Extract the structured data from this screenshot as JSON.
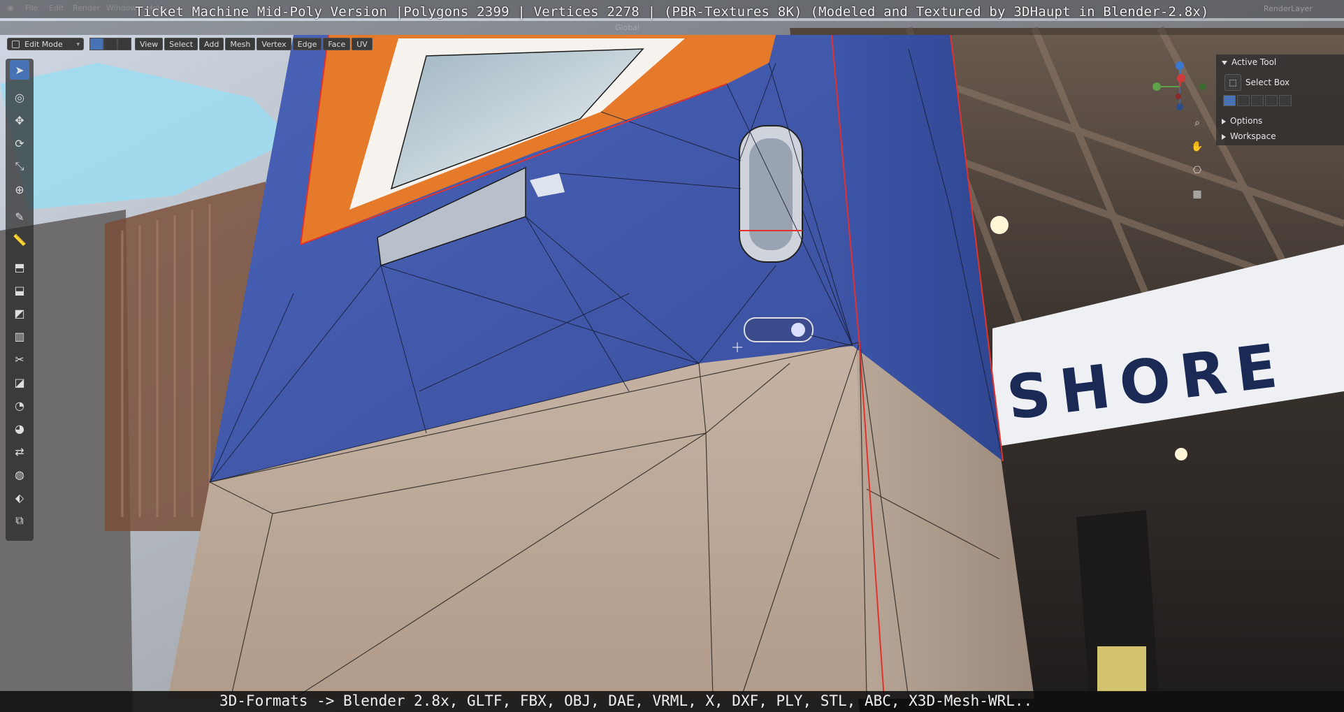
{
  "window": {
    "caption": "Ticket Machine Mid-Poly Version |Polygons 2399 | Vertices 2278 | (PBR-Textures 8K) (Modeled and Textured by 3DHaupt in Blender-2.8x)",
    "render_layer": "RenderLayer"
  },
  "topbar": {
    "menu": [
      "File",
      "Edit",
      "Render",
      "Window",
      "Help"
    ]
  },
  "viewport_header": {
    "mode": "Edit Mode",
    "menus": [
      "View",
      "Select",
      "Add",
      "Mesh",
      "Vertex",
      "Edge",
      "Face",
      "UV"
    ],
    "transform_orientation": "Global"
  },
  "toolbar": {
    "tools": [
      {
        "name": "select-box",
        "icon": "cursor-arrow-icon",
        "active": true
      },
      {
        "name": "cursor",
        "icon": "crosshair-cursor-icon",
        "active": false
      },
      {
        "name": "move",
        "icon": "move-arrows-icon",
        "active": false
      },
      {
        "name": "rotate",
        "icon": "rotate-icon",
        "active": false
      },
      {
        "name": "scale",
        "icon": "scale-icon",
        "active": false
      },
      {
        "name": "transform",
        "icon": "transform-icon",
        "active": false
      },
      {
        "name": "annotate",
        "icon": "annotate-pen-icon",
        "active": false
      },
      {
        "name": "measure",
        "icon": "ruler-icon",
        "active": false
      },
      {
        "name": "extrude",
        "icon": "extrude-icon",
        "active": false
      },
      {
        "name": "inset",
        "icon": "inset-icon",
        "active": false
      },
      {
        "name": "bevel",
        "icon": "bevel-icon",
        "active": false
      },
      {
        "name": "loop-cut",
        "icon": "loop-cut-icon",
        "active": false
      },
      {
        "name": "knife",
        "icon": "knife-icon",
        "active": false
      },
      {
        "name": "poly-build",
        "icon": "poly-build-icon",
        "active": false
      },
      {
        "name": "spin",
        "icon": "spin-icon",
        "active": false
      },
      {
        "name": "smooth",
        "icon": "smooth-icon",
        "active": false
      },
      {
        "name": "edge-slide",
        "icon": "edge-slide-icon",
        "active": false
      },
      {
        "name": "shrink-fatten",
        "icon": "shrink-fatten-icon",
        "active": false
      },
      {
        "name": "shear",
        "icon": "shear-icon",
        "active": false
      },
      {
        "name": "rip",
        "icon": "rip-icon",
        "active": false
      }
    ]
  },
  "npanel": {
    "active_tool_header": "Active Tool",
    "active_tool_name": "Select Box",
    "options_header": "Options",
    "workspace_header": "Workspace"
  },
  "scene": {
    "sign_text": "SHORE",
    "colors": {
      "upper_panel": "#3d55a8",
      "lower_panel": "#b4a090",
      "accent_orange": "#e57a2a",
      "selected_edge": "#e3312c"
    }
  },
  "bottom": {
    "caption": "3D-Formats -> Blender 2.8x, GLTF, FBX, OBJ, DAE, VRML, X, DXF, PLY, STL, ABC, X3D-Mesh-WRL.."
  }
}
